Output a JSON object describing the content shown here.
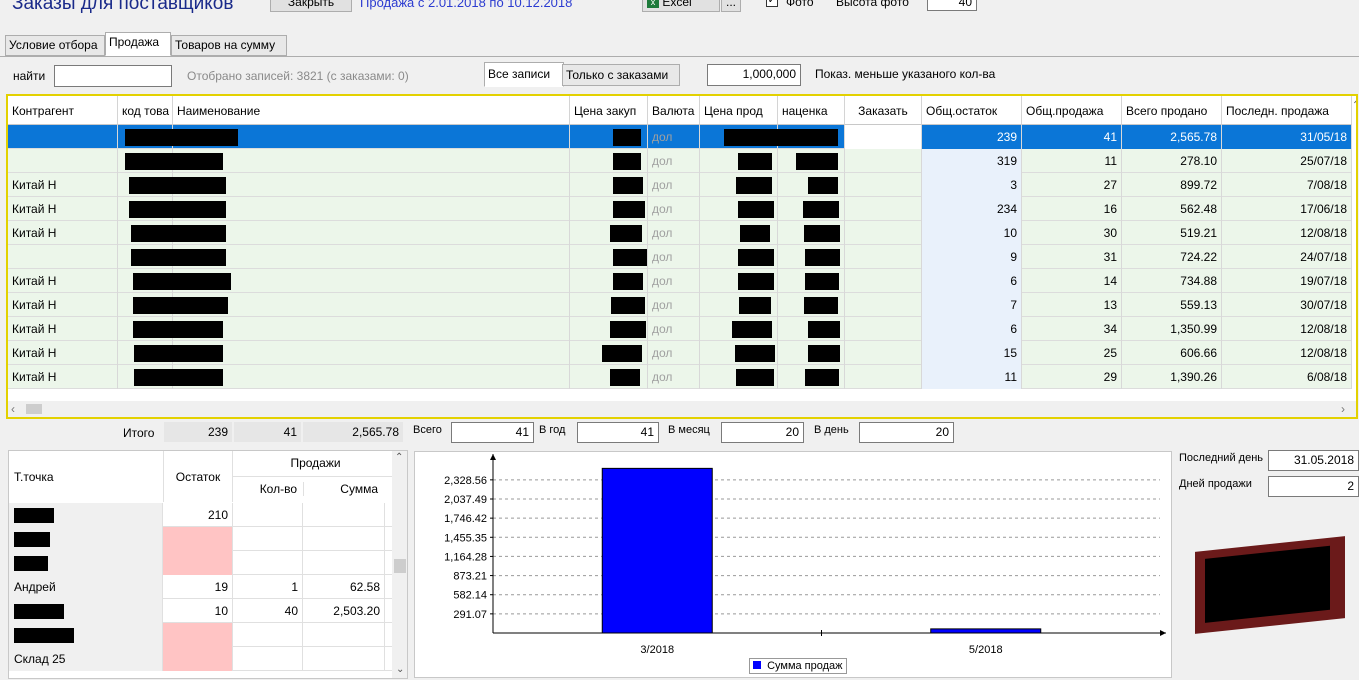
{
  "window": {
    "title": "Заказы для поставщиков",
    "close_label": "Закрыть",
    "period": "Продажа с  2.01.2018 по 10.12.2018",
    "excel_label": "Excel",
    "more_label": "...",
    "photo_label": "Фото",
    "photo_height_label": "Высота фото",
    "photo_height_value": "40"
  },
  "tabs": [
    "Условие отбора",
    "Продажа",
    "Товаров на сумму"
  ],
  "filter": {
    "find_label": "найти",
    "find_value": "",
    "records": "Отобрано записей: 3821 (с заказами: 0)",
    "all_label": "Все записи",
    "only_orders_label": "Только с заказами",
    "threshold_value": "1,000,000",
    "threshold_label": "Показ. меньше указаного кол-ва"
  },
  "grid": {
    "columns": [
      "Контрагент",
      "код това",
      "Наименование",
      "Цена закуп",
      "Валюта",
      "Цена прод",
      "наценка",
      "Заказать",
      "Общ.остаток",
      "Общ.продажа",
      "Всего продано",
      "Последн. продажа"
    ],
    "currency": "дол",
    "rows": [
      {
        "agent": "",
        "stock": "239",
        "sold": "41",
        "total": "2,565.78",
        "last": "31/05/18"
      },
      {
        "agent": "",
        "stock": "319",
        "sold": "11",
        "total": "278.10",
        "last": "25/07/18"
      },
      {
        "agent": "Китай Н",
        "stock": "3",
        "sold": "27",
        "total": "899.72",
        "last": "7/08/18"
      },
      {
        "agent": "Китай Н",
        "stock": "234",
        "sold": "16",
        "total": "562.48",
        "last": "17/06/18"
      },
      {
        "agent": "Китай Н",
        "stock": "10",
        "sold": "30",
        "total": "519.21",
        "last": "12/08/18"
      },
      {
        "agent": "",
        "stock": "9",
        "sold": "31",
        "total": "724.22",
        "last": "24/07/18"
      },
      {
        "agent": "Китай Н",
        "stock": "6",
        "sold": "14",
        "total": "734.88",
        "last": "19/07/18"
      },
      {
        "agent": "Китай Н",
        "stock": "7",
        "sold": "13",
        "total": "559.13",
        "last": "30/07/18"
      },
      {
        "agent": "Китай Н",
        "stock": "6",
        "sold": "34",
        "total": "1,350.99",
        "last": "12/08/18"
      },
      {
        "agent": "Китай Н",
        "stock": "15",
        "sold": "25",
        "total": "606.66",
        "last": "12/08/18"
      },
      {
        "agent": "Китай Н",
        "stock": "11",
        "sold": "29",
        "total": "1,390.26",
        "last": "6/08/18"
      }
    ]
  },
  "summary": {
    "total_label": "Итого",
    "stock": "239",
    "sold": "41",
    "sum": "2,565.78",
    "all_label": "Всего",
    "all_value": "41",
    "year_label": "В год",
    "year_value": "41",
    "month_label": "В месяц",
    "month_value": "20",
    "day_label": "В день",
    "day_value": "20"
  },
  "points": {
    "header_point": "Т.точка",
    "header_stock": "Остаток",
    "header_sales": "Продажи",
    "header_qty": "Кол-во",
    "header_sum": "Сумма",
    "rows": [
      {
        "name": "",
        "stock": "210",
        "qty": "",
        "sum": "",
        "pink": false
      },
      {
        "name": "",
        "stock": "",
        "qty": "",
        "sum": "",
        "pink": true
      },
      {
        "name": "",
        "stock": "",
        "qty": "",
        "sum": "",
        "pink": true
      },
      {
        "name": "Андрей",
        "stock": "19",
        "qty": "1",
        "sum": "62.58",
        "pink": false
      },
      {
        "name": "",
        "stock": "10",
        "qty": "40",
        "sum": "2,503.20",
        "pink": false
      },
      {
        "name": "",
        "stock": "",
        "qty": "",
        "sum": "",
        "pink": true
      },
      {
        "name": "Склад 25",
        "stock": "",
        "qty": "",
        "sum": "",
        "pink": true
      }
    ]
  },
  "chart_data": {
    "type": "bar",
    "categories": [
      "3/2018",
      "5/2018"
    ],
    "series": [
      {
        "name": "Сумма продаж",
        "values": [
          2503.2,
          62.58
        ],
        "color": "#0000ff"
      }
    ],
    "yticks": [
      "291.07",
      "582.14",
      "873.21",
      "1,164.28",
      "1,455.35",
      "1,746.42",
      "2,037.49",
      "2,328.56"
    ],
    "ylim": [
      0,
      2600
    ],
    "grid": true,
    "legend": "bottom"
  },
  "side": {
    "last_day_label": "Последний день",
    "last_day_value": "31.05.2018",
    "sale_days_label": "Дней продажи",
    "sale_days_value": "2"
  }
}
